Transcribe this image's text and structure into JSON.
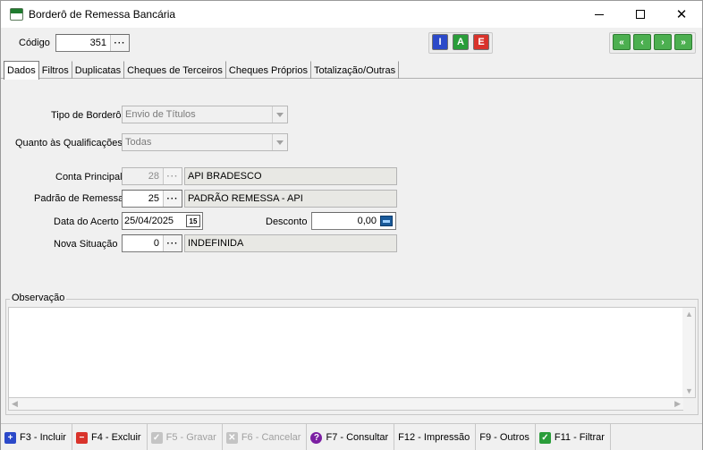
{
  "window": {
    "title": "Borderô de Remessa Bancária"
  },
  "header": {
    "codigo_label": "Código",
    "codigo_value": "351",
    "iae_buttons": [
      {
        "label": "I",
        "color": "#2b49c9"
      },
      {
        "label": "A",
        "color": "#2a9d3a"
      },
      {
        "label": "E",
        "color": "#d9332b"
      }
    ],
    "nav_buttons": [
      "«",
      "‹",
      "›",
      "»"
    ]
  },
  "tabs": [
    {
      "label": "Dados",
      "active": true
    },
    {
      "label": "Filtros"
    },
    {
      "label": "Duplicatas"
    },
    {
      "label": "Cheques de Terceiros"
    },
    {
      "label": "Cheques Próprios"
    },
    {
      "label": "Totalização/Outras"
    }
  ],
  "form": {
    "tipo_label": "Tipo de Borderô",
    "tipo_value": "Envio de Títulos",
    "quanto_label": "Quanto às Qualificações",
    "quanto_value": "Todas",
    "conta_label": "Conta Principal",
    "conta_code": "28",
    "conta_desc": "API BRADESCO",
    "padrao_label": "Padrão de Remessa",
    "padrao_code": "25",
    "padrao_desc": "PADRÃO REMESSA - API",
    "data_label": "Data do Acerto",
    "data_value": "25/04/2025",
    "desconto_label": "Desconto",
    "desconto_value": "0,00",
    "situacao_label": "Nova Situação",
    "situacao_code": "0",
    "situacao_desc": "INDEFINIDA"
  },
  "observacao": {
    "label": "Observação",
    "value": ""
  },
  "bottom": {
    "buttons": [
      {
        "label": "F3 - Incluir",
        "icon": "plus-icon",
        "color": "#2b49c9",
        "glyph": "+",
        "enabled": true
      },
      {
        "label": "F4 - Excluir",
        "icon": "minus-icon",
        "color": "#d9332b",
        "glyph": "−",
        "enabled": true
      },
      {
        "label": "F5 - Gravar",
        "icon": "check-icon",
        "color": "#b8b8b8",
        "glyph": "✓",
        "enabled": false
      },
      {
        "label": "F6 - Cancelar",
        "icon": "x-icon",
        "color": "#b8b8b8",
        "glyph": "✕",
        "enabled": false
      },
      {
        "label": "F7 - Consultar",
        "icon": "question-icon",
        "color": "#7b1fa2",
        "glyph": "?",
        "enabled": true
      },
      {
        "label": "F12 - Impressão",
        "icon": "",
        "color": "",
        "glyph": "",
        "enabled": true
      },
      {
        "label": "F9 - Outros",
        "icon": "",
        "color": "",
        "glyph": "",
        "enabled": true
      },
      {
        "label": "F11 - Filtrar",
        "icon": "filter-check-icon",
        "color": "#2a9d3a",
        "glyph": "✓",
        "enabled": true
      }
    ]
  }
}
